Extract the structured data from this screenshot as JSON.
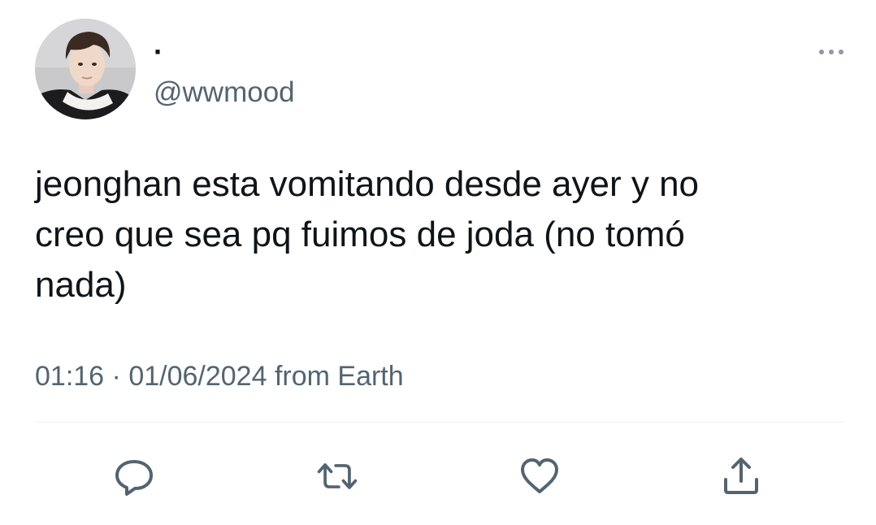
{
  "user": {
    "display_name": "·",
    "handle": "@wwmood"
  },
  "tweet": {
    "text": "jeonghan esta vomitando desde ayer y no\ncreo que sea pq fuimos de joda (no tomó\nnada)",
    "time": "01:16",
    "separator": "·",
    "date": "01/06/2024",
    "source": "from Earth"
  },
  "actions": {
    "icons": [
      "reply-icon",
      "retweet-icon",
      "like-icon",
      "share-icon"
    ]
  },
  "colors": {
    "text": "#0f1419",
    "secondary": "#536471",
    "divider": "#eff3f4",
    "icon": "#536471"
  }
}
